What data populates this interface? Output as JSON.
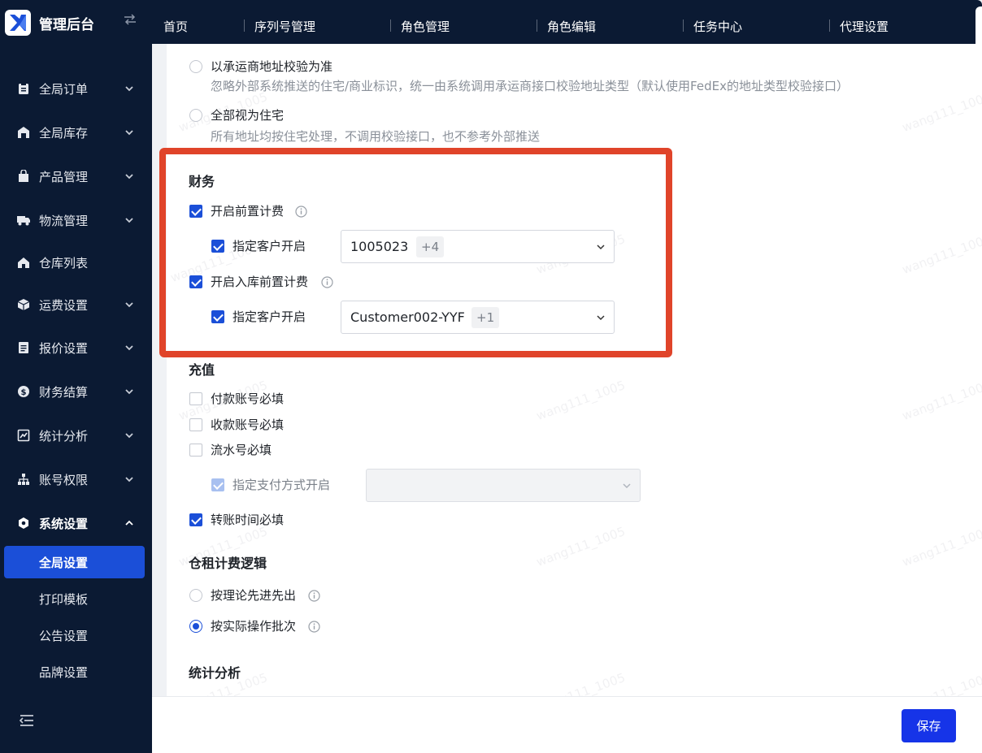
{
  "sidebar": {
    "app_title": "管理后台",
    "menu": [
      {
        "label": "全局订单",
        "icon": "clipboard-icon"
      },
      {
        "label": "全局库存",
        "icon": "warehouse-icon"
      },
      {
        "label": "产品管理",
        "icon": "shopping-bag-icon"
      },
      {
        "label": "物流管理",
        "icon": "truck-icon"
      },
      {
        "label": "仓库列表",
        "icon": "home-icon"
      },
      {
        "label": "运费设置",
        "icon": "box-icon"
      },
      {
        "label": "报价设置",
        "icon": "document-icon"
      },
      {
        "label": "财务结算",
        "icon": "dollar-icon"
      },
      {
        "label": "统计分析",
        "icon": "chart-icon"
      },
      {
        "label": "账号权限",
        "icon": "org-tree-icon"
      },
      {
        "label": "系统设置",
        "icon": "hexagon-settings-icon"
      }
    ],
    "submenu": [
      {
        "label": "全局设置"
      },
      {
        "label": "打印模板"
      },
      {
        "label": "公告设置"
      },
      {
        "label": "品牌设置"
      }
    ]
  },
  "topnav": {
    "tabs": [
      "首页",
      "序列号管理",
      "角色管理",
      "角色编辑",
      "任务中心",
      "代理设置"
    ]
  },
  "address": {
    "option1_label": "以承运商地址校验为准",
    "option1_desc": "忽略外部系统推送的住宅/商业标识，统一由系统调用承运商接口校验地址类型（默认使用FedEx的地址类型校验接口）",
    "option2_label": "全部视为住宅",
    "option2_desc": "所有地址均按住宅处理，不调用校验接口，也不参考外部推送"
  },
  "finance": {
    "title": "财务",
    "pre_billing_label": "开启前置计费",
    "pre_billing_customer_label": "指定客户开启",
    "pre_billing_customer_value": "1005023",
    "pre_billing_customer_more": "+4",
    "inbound_pre_billing_label": "开启入库前置计费",
    "inbound_customer_label": "指定客户开启",
    "inbound_customer_value": "Customer002-YYF",
    "inbound_customer_more": "+1"
  },
  "recharge": {
    "title": "充值",
    "payment_account_label": "付款账号必填",
    "receive_account_label": "收款账号必填",
    "serial_no_label": "流水号必填",
    "payment_method_label": "指定支付方式开启",
    "transfer_time_label": "转账时间必填"
  },
  "storage": {
    "title": "仓租计费逻辑",
    "fifo_label": "按理论先进先出",
    "actual_batch_label": "按实际操作批次"
  },
  "stats": {
    "title": "统计分析"
  },
  "footer": {
    "save_label": "保存"
  },
  "watermark": "wang111_1005",
  "colors": {
    "primary": "#1b4fd8",
    "sidebar_bg": "#0b1a33",
    "highlight": "#e0442a"
  }
}
